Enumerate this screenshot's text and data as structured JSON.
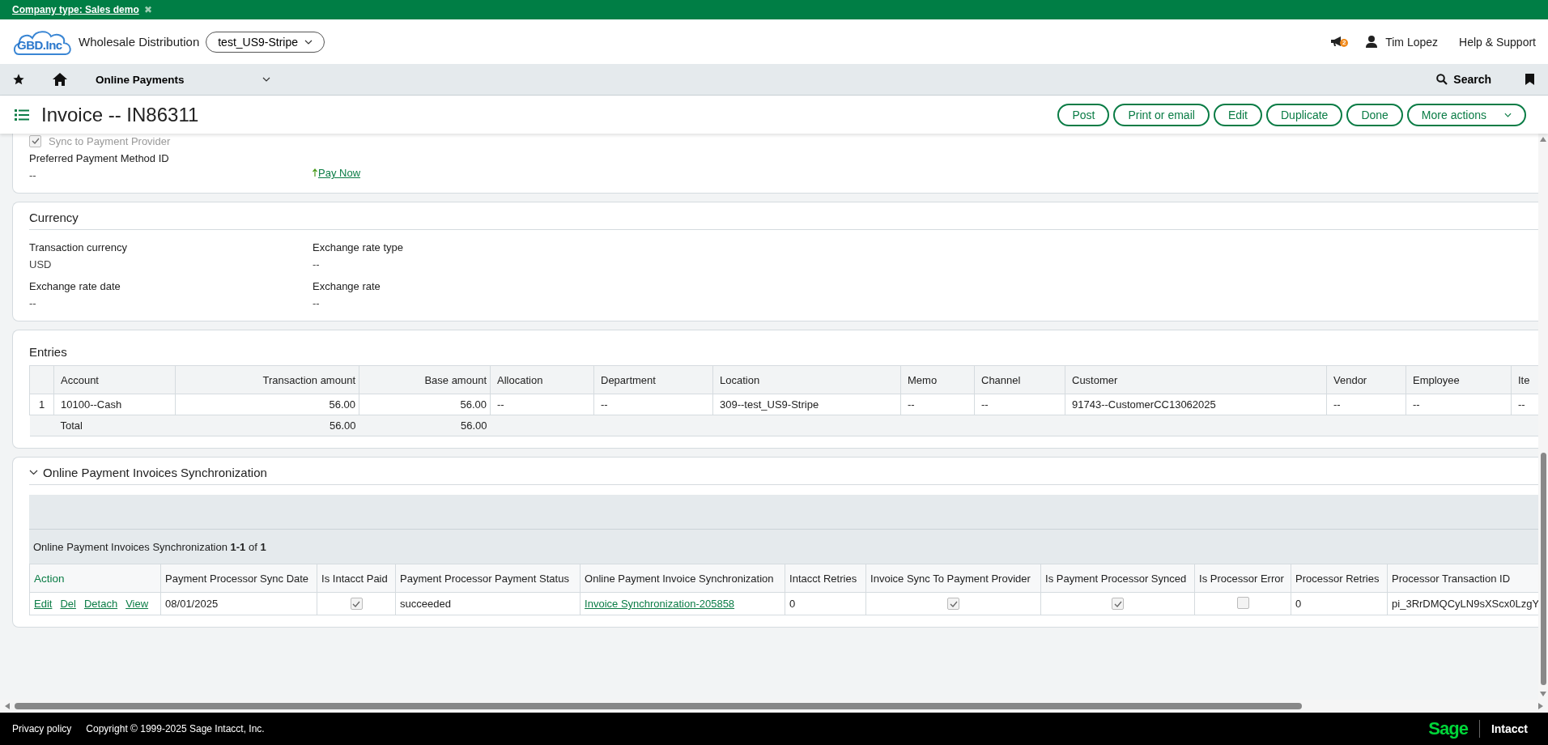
{
  "banner": {
    "text": "Company type: Sales demo",
    "close": "✖"
  },
  "header": {
    "logo_text": "GBD.Inc",
    "company": "Wholesale Distribution",
    "entity": "test_US9-Stripe",
    "notifications": "2",
    "user": "Tim Lopez",
    "help": "Help & Support"
  },
  "nav": {
    "module": "Online Payments",
    "search": "Search"
  },
  "title": "Invoice -- IN86311",
  "actions": [
    "Post",
    "Print or email",
    "Edit",
    "Duplicate",
    "Done"
  ],
  "more_actions": "More actions",
  "payment": {
    "checkbox": {
      "label": "Sync to Payment Provider",
      "checked": true,
      "disabled": true
    },
    "field": {
      "label": "Preferred Payment Method ID",
      "value": "--"
    },
    "link": "Pay Now"
  },
  "currency": {
    "title": "Currency",
    "fields": [
      {
        "label": "Transaction currency",
        "value": "USD"
      },
      {
        "label": "Exchange rate type",
        "value": "--"
      },
      {
        "label": "Exchange rate date",
        "value": "--"
      },
      {
        "label": "Exchange rate",
        "value": "--"
      }
    ]
  },
  "entries": {
    "title": "Entries",
    "columns": [
      {
        "label": "Account",
        "kind": "text"
      },
      {
        "label": "Transaction amount",
        "kind": "amount"
      },
      {
        "label": "Base amount",
        "kind": "amount"
      },
      {
        "label": "Allocation",
        "kind": "text"
      },
      {
        "label": "Department",
        "kind": "text"
      },
      {
        "label": "Location",
        "kind": "text"
      },
      {
        "label": "Memo",
        "kind": "text"
      },
      {
        "label": "Channel",
        "kind": "text"
      },
      {
        "label": "Customer",
        "kind": "text"
      },
      {
        "label": "Vendor",
        "kind": "text"
      },
      {
        "label": "Employee",
        "kind": "text"
      },
      {
        "label": "Ite",
        "kind": "text"
      }
    ],
    "rows": [
      {
        "number": "1",
        "cells": [
          "10100--Cash",
          "56.00",
          "56.00",
          "--",
          "--",
          "309--test_US9-Stripe",
          "--",
          "--",
          "91743--CustomerCC13062025",
          "--",
          "--",
          "--"
        ]
      }
    ],
    "total": {
      "label": "Total",
      "cells": [
        "56.00",
        "56.00"
      ]
    }
  },
  "sync": {
    "title": "Online Payment Invoices Synchronization",
    "expanded": true,
    "caption": "Online Payment Invoices Synchronization **1-1** of **1**",
    "columns": [
      "Action",
      "Payment Processor Sync Date",
      "Is Intacct Paid",
      "Payment Processor Payment Status",
      "Online Payment Invoice Synchronization",
      "Intacct Retries",
      "Invoice Sync To Payment Provider",
      "Is Payment Processor Synced",
      "Is Processor Error",
      "Processor Retries",
      "Processor Transaction ID"
    ],
    "rows": [
      {
        "cells": [
          {
            "kind": "actions",
            "links": [
              "Edit",
              "Del",
              "Detach",
              "View"
            ]
          },
          {
            "kind": "text",
            "value": "08/01/2025"
          },
          {
            "kind": "checkbox",
            "checked": true
          },
          {
            "kind": "text",
            "value": "succeeded"
          },
          {
            "kind": "link",
            "value": "Invoice Synchronization-205858"
          },
          {
            "kind": "text",
            "value": "0"
          },
          {
            "kind": "checkbox",
            "checked": true
          },
          {
            "kind": "checkbox",
            "checked": true
          },
          {
            "kind": "checkbox",
            "checked": false
          },
          {
            "kind": "text",
            "value": "0"
          },
          {
            "kind": "text",
            "value": "pi_3RrDMQCyLN9sXScx0LzgY"
          }
        ]
      }
    ]
  },
  "footer": {
    "privacy": "Privacy policy",
    "copyright": "Copyright © 1999-2025 Sage Intacct, Inc.",
    "brand": "Sage",
    "product": "Intacct"
  }
}
